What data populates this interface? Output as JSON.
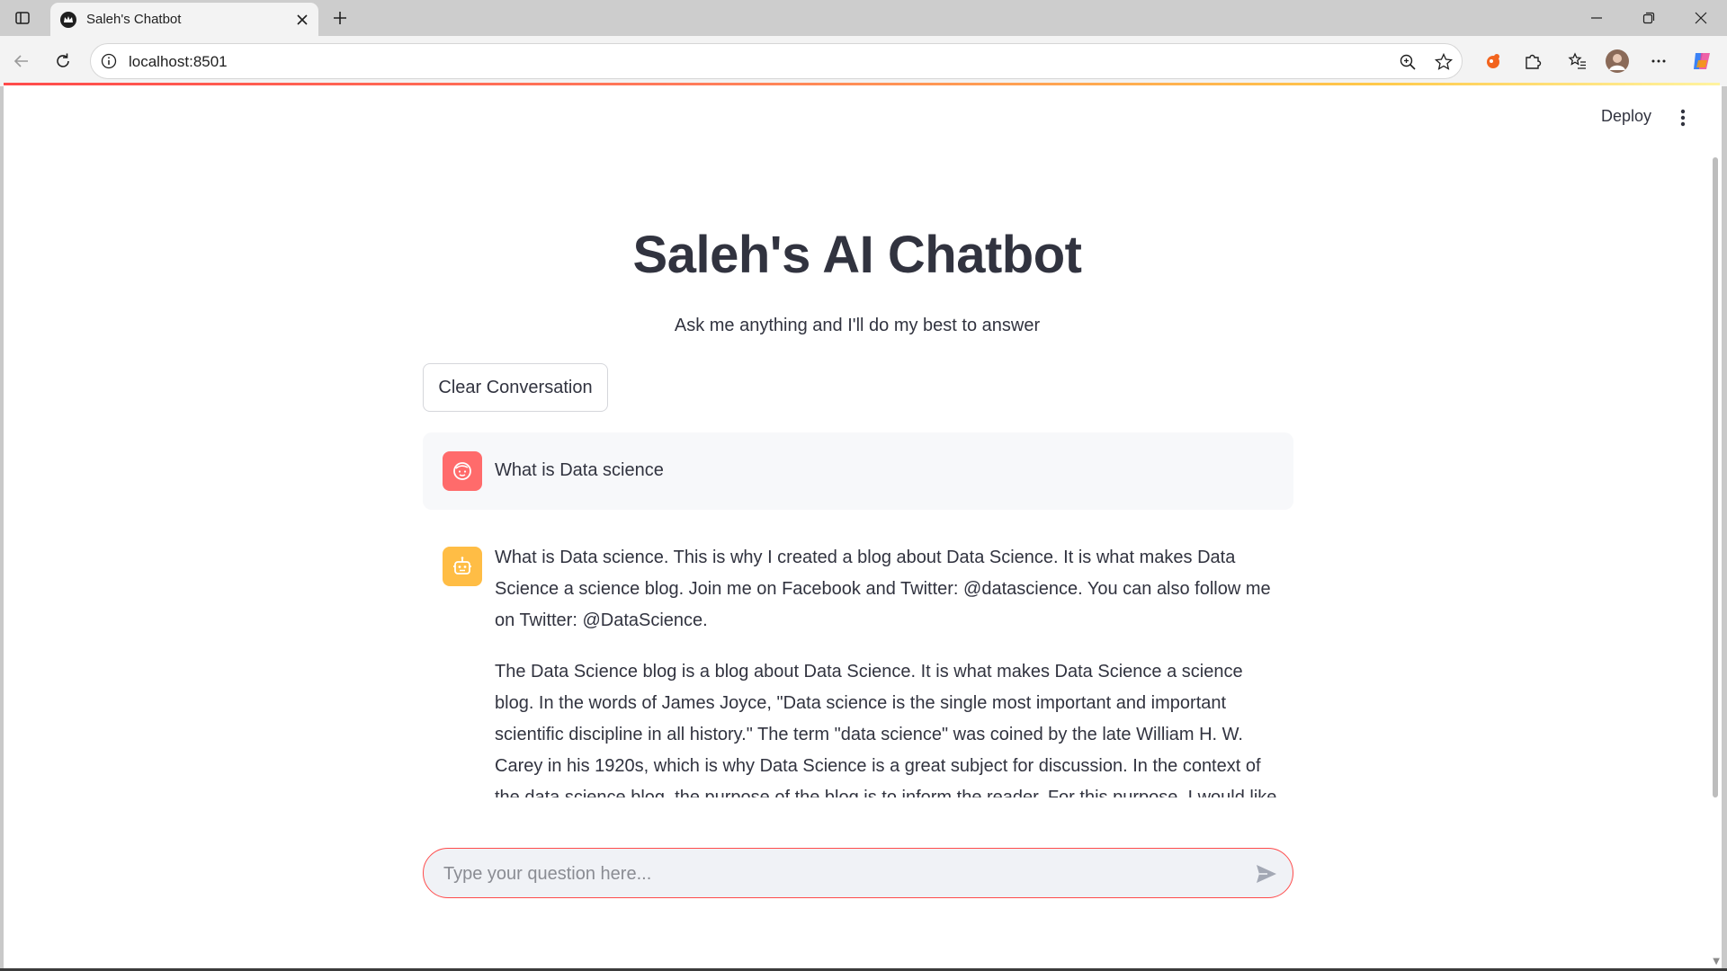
{
  "browser": {
    "tab": {
      "title": "Saleh's Chatbot",
      "favicon": "streamlit-crown-icon"
    },
    "url": "localhost:8501",
    "icons": {
      "back": "arrow-left-icon",
      "reload": "reload-icon",
      "info": "info-icon",
      "zoom": "zoom-icon",
      "favorite": "star-icon",
      "extension": "puzzle-icon",
      "collections": "favorites-list-icon",
      "profile": "profile-avatar-icon",
      "more": "ellipsis-icon",
      "copilot": "copilot-icon"
    }
  },
  "app": {
    "header": {
      "deploy_label": "Deploy"
    },
    "title": "Saleh's AI Chatbot",
    "subtitle": "Ask me anything and I'll do my best to answer",
    "clear_button": "Clear Conversation",
    "messages": [
      {
        "role": "user",
        "avatar": "user-face-icon",
        "text": "What is Data science"
      },
      {
        "role": "assistant",
        "avatar": "robot-icon",
        "paragraphs": [
          "What is Data science. This is why I created a blog about Data Science. It is what makes Data Science a science blog. Join me on Facebook and Twitter: @datascience. You can also follow me on Twitter: @DataScience.",
          "The Data Science blog is a blog about Data Science. It is what makes Data Science a science blog. In the words of James Joyce, \"Data science is the single most important and important scientific discipline in all history.\" The term \"data science\" was coined by the late William H. W. Carey in his 1920s, which is why Data Science is a great subject for discussion. In the context of the data science blog, the purpose of the blog is to inform the reader. For this purpose, I would like to"
        ]
      }
    ],
    "input": {
      "placeholder": "Type your question here...",
      "value": ""
    }
  },
  "colors": {
    "accent": "#ff4b4b",
    "user_avatar": "#ff6b6b",
    "bot_avatar": "#ffbd45",
    "text": "#31333f",
    "user_bubble": "#f7f8fa"
  }
}
